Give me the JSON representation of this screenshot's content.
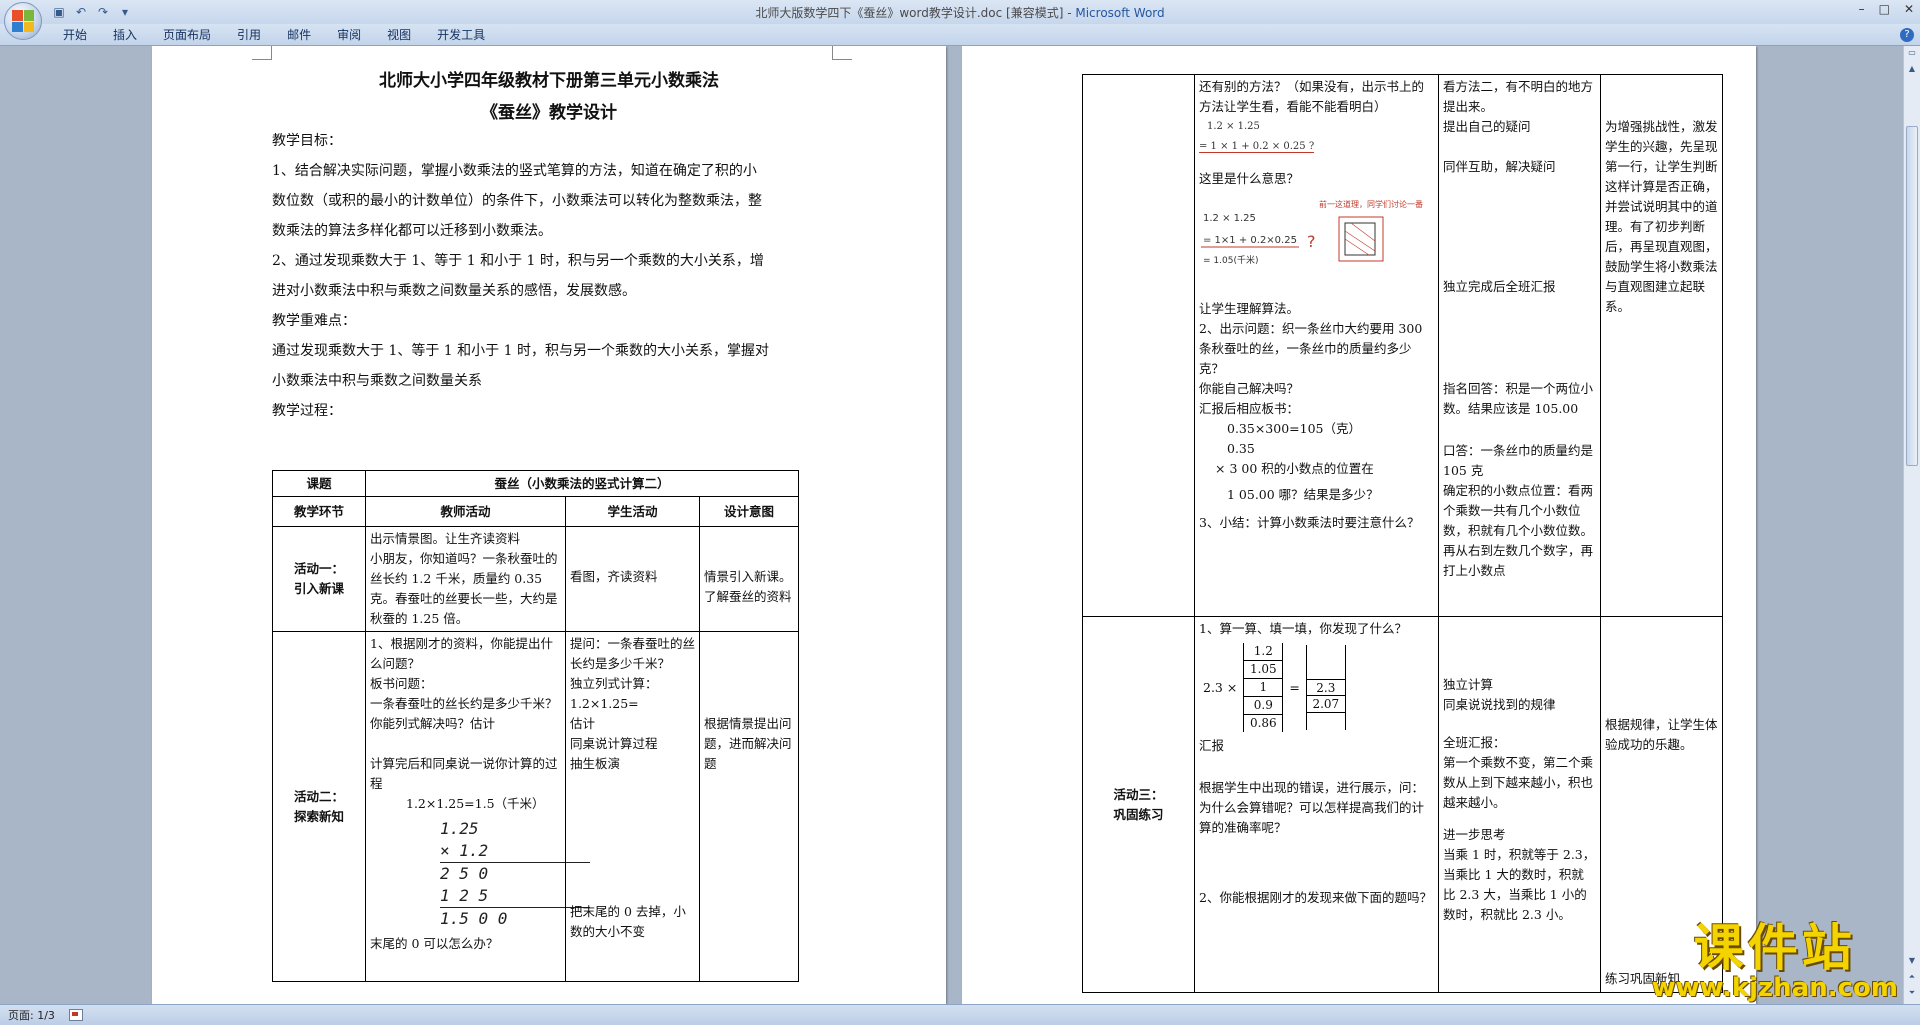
{
  "window": {
    "title": "北师大版数学四下《蚕丝》word教学设计.doc [兼容模式] - ",
    "app_name": "Microsoft Word"
  },
  "ribbon": {
    "tabs": [
      "开始",
      "插入",
      "页面布局",
      "引用",
      "邮件",
      "审阅",
      "视图",
      "开发工具"
    ]
  },
  "status": {
    "page": "页面: 1/3"
  },
  "page1": {
    "title1": "北师大小学四年级教材下册第三单元小数乘法",
    "title2": "《蚕丝》教学设计",
    "paras": [
      "教学目标：",
      "1、结合解决实际问题，掌握小数乘法的竖式笔算的方法，知道在确定了积的小",
      "数位数（或积的最小的计数单位）的条件下，小数乘法可以转化为整数乘法，整",
      "数乘法的算法多样化都可以迁移到小数乘法。",
      "2、通过发现乘数大于 1、等于 1 和小于 1 时，积与另一个乘数的大小关系，增",
      "进对小数乘法中积与乘数之间数量关系的感悟，发展数感。",
      "教学重难点：",
      "通过发现乘数大于 1、等于 1 和小于 1 时，积与另一个乘数的大小关系，掌握对",
      "小数乘法中积与乘数之间数量关系",
      "教学过程："
    ],
    "table": {
      "topic_label": "课题",
      "topic_value": "蚕丝（小数乘法的竖式计算二）",
      "headers": [
        "教学环节",
        "教师活动",
        "学生活动",
        "设计意图"
      ],
      "row1": {
        "stage": "活动一：\n引入新课",
        "teacher": [
          "出示情景图。让生齐读资料",
          "小朋友，你知道吗？一条秋蚕吐的丝长约 1.2 千米，质量约 0.35 克。春蚕吐的丝要长一些，大约是秋蚕的 1.25 倍。"
        ],
        "student": "看图，齐读资料",
        "intent": "情景引入新课。了解蚕丝的资料"
      },
      "row2": {
        "stage": "活动二：\n探索新知",
        "teacher": [
          "1、根据刚才的资料，你能提出什么问题？",
          "板书问题：",
          "一条春蚕吐的丝长约是多少千米？",
          "你能列式解决吗？估计",
          "",
          "计算完后和同桌说一说你计算的过程",
          "1.2×1.25=1.5（千米）"
        ],
        "calc": [
          "1.25",
          "×  1.2",
          "2 5 0",
          "1 2 5",
          "1.5 0 0"
        ],
        "teacher_end": "末尾的 0 可以怎么办？",
        "student": [
          "提问：一条春蚕吐的丝长约是多少千米？",
          "独立列式计算：",
          "1.2×1.25=",
          "估计",
          "同桌说计算过程",
          "抽生板演"
        ],
        "student_end": "把末尾的 0 去掉，小数的大小不变",
        "intent": "根据情景提出问题，进而解决问题"
      }
    }
  },
  "page2": {
    "row_a": {
      "teacher": [
        "还有别的方法？（如果没有，出示书上的方法让学生看，看能不能看明白）",
        "1.2 × 1.25",
        "= 1 × 1 + 0.2 × 0.25 ?",
        "这里是什么意思？",
        "让学生理解算法。",
        "2、出示问题：织一条丝巾大约要用 300 条秋蚕吐的丝，一条丝巾的质量约多少克？",
        "你能自己解决吗？",
        "汇报后相应板书：",
        "0.35×300=105（克）",
        "0.35",
        "×    3 00     积的小数点的位置在",
        "1 05.00       哪？结果是多少？",
        "3、小结：计算小数乘法时要注意什么？"
      ],
      "sketch_note": "前一这道理，同学们讨论一番",
      "student": [
        "看方法二，有不明白的地方提出来。",
        "提出自己的疑问",
        "同伴互助，解决疑问",
        "独立完成后全班汇报",
        "指名回答：积是一个两位小数。结果应该是 105.00",
        "口答：一条丝巾的质量约是 105 克",
        "确定积的小数点位置：看两个乘数一共有几个小数位数，积就有几个小数位数。再从右到左数几个数字，再打上小数点"
      ],
      "intent": "为增强挑战性，激发学生的兴趣，先呈现第一行，让学生判断这样计算是否正确，并尝试说明其中的道理。有了初步判断后，再呈现直观图，鼓励学生将小数乘法与直观图建立起联系。"
    },
    "row_b": {
      "stage": "活动三：\n巩固练习",
      "teacher": [
        "1、算一算、填一填，你发现了什么？",
        "汇报",
        "根据学生中出现的错误，进行展示，问：为什么会算错呢？可以怎样提高我们的计算的准确率呢？",
        "2、你能根据刚才的发现来做下面的题吗？"
      ],
      "grid": {
        "multiplier": "2.3 ×",
        "left": [
          "1.2",
          "1.05",
          "1",
          "0.9",
          "0.86"
        ],
        "right": [
          "",
          "",
          "2.3",
          "2.07",
          ""
        ]
      },
      "student": [
        "独立计算",
        "同桌说说找到的规律",
        "全班汇报：",
        "第一个乘数不变，第二个乘数从上到下越来越小，积也越来越小。",
        "进一步思考",
        "当乘 1 时，积就等于 2.3，当乘比 1 大的数时，积就比 2.3 大，当乘比 1 小的数时，积就比 2.3 小。"
      ],
      "intent": "根据规律，让学生体验成功的乐趣。",
      "intent_end": "练习巩固新知"
    }
  },
  "watermark": {
    "cn": "课件站",
    "en": "www.kjzhan.com"
  }
}
